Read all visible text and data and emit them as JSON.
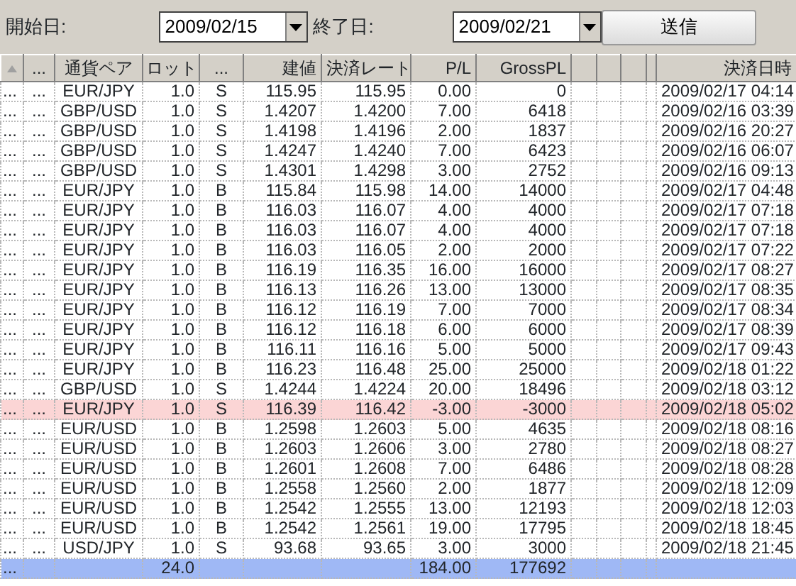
{
  "filter": {
    "start_label": "開始日:",
    "start_value": "2009/02/15",
    "end_label": "終了日:",
    "end_value": "2009/02/21",
    "submit": "送信"
  },
  "table": {
    "columns": [
      null,
      "...",
      "通貨ペア",
      "ロット",
      "...",
      "建値",
      "決済レート",
      "P/L",
      "GrossPL",
      null,
      null,
      null,
      null,
      "決済日時"
    ],
    "rows": [
      {
        "highlighted": false,
        "cells": [
          "...",
          "...",
          "EUR/JPY",
          "1.0",
          "S",
          "115.95",
          "115.95",
          "0.00",
          "0",
          null,
          null,
          null,
          null,
          "2009/02/17 04:14"
        ]
      },
      {
        "highlighted": false,
        "cells": [
          "...",
          "...",
          "GBP/USD",
          "1.0",
          "S",
          "1.4207",
          "1.4200",
          "7.00",
          "6418",
          null,
          null,
          null,
          null,
          "2009/02/16 03:39"
        ]
      },
      {
        "highlighted": false,
        "cells": [
          "...",
          "...",
          "GBP/USD",
          "1.0",
          "S",
          "1.4198",
          "1.4196",
          "2.00",
          "1837",
          null,
          null,
          null,
          null,
          "2009/02/16 20:27"
        ]
      },
      {
        "highlighted": false,
        "cells": [
          "...",
          "...",
          "GBP/USD",
          "1.0",
          "S",
          "1.4247",
          "1.4240",
          "7.00",
          "6423",
          null,
          null,
          null,
          null,
          "2009/02/16 06:07"
        ]
      },
      {
        "highlighted": false,
        "cells": [
          "...",
          "...",
          "GBP/USD",
          "1.0",
          "S",
          "1.4301",
          "1.4298",
          "3.00",
          "2752",
          null,
          null,
          null,
          null,
          "2009/02/16 09:13"
        ]
      },
      {
        "highlighted": false,
        "cells": [
          "...",
          "...",
          "EUR/JPY",
          "1.0",
          "B",
          "115.84",
          "115.98",
          "14.00",
          "14000",
          null,
          null,
          null,
          null,
          "2009/02/17 04:48"
        ]
      },
      {
        "highlighted": false,
        "cells": [
          "...",
          "...",
          "EUR/JPY",
          "1.0",
          "B",
          "116.03",
          "116.07",
          "4.00",
          "4000",
          null,
          null,
          null,
          null,
          "2009/02/17 07:18"
        ]
      },
      {
        "highlighted": false,
        "cells": [
          "...",
          "...",
          "EUR/JPY",
          "1.0",
          "B",
          "116.03",
          "116.07",
          "4.00",
          "4000",
          null,
          null,
          null,
          null,
          "2009/02/17 07:18"
        ]
      },
      {
        "highlighted": false,
        "cells": [
          "...",
          "...",
          "EUR/JPY",
          "1.0",
          "B",
          "116.03",
          "116.05",
          "2.00",
          "2000",
          null,
          null,
          null,
          null,
          "2009/02/17 07:22"
        ]
      },
      {
        "highlighted": false,
        "cells": [
          "...",
          "...",
          "EUR/JPY",
          "1.0",
          "B",
          "116.19",
          "116.35",
          "16.00",
          "16000",
          null,
          null,
          null,
          null,
          "2009/02/17 08:27"
        ]
      },
      {
        "highlighted": false,
        "cells": [
          "...",
          "...",
          "EUR/JPY",
          "1.0",
          "B",
          "116.13",
          "116.26",
          "13.00",
          "13000",
          null,
          null,
          null,
          null,
          "2009/02/17 08:35"
        ]
      },
      {
        "highlighted": false,
        "cells": [
          "...",
          "...",
          "EUR/JPY",
          "1.0",
          "B",
          "116.12",
          "116.19",
          "7.00",
          "7000",
          null,
          null,
          null,
          null,
          "2009/02/17 08:34"
        ]
      },
      {
        "highlighted": false,
        "cells": [
          "...",
          "...",
          "EUR/JPY",
          "1.0",
          "B",
          "116.12",
          "116.18",
          "6.00",
          "6000",
          null,
          null,
          null,
          null,
          "2009/02/17 08:39"
        ]
      },
      {
        "highlighted": false,
        "cells": [
          "...",
          "...",
          "EUR/JPY",
          "1.0",
          "B",
          "116.11",
          "116.16",
          "5.00",
          "5000",
          null,
          null,
          null,
          null,
          "2009/02/17 09:43"
        ]
      },
      {
        "highlighted": false,
        "cells": [
          "...",
          "...",
          "EUR/JPY",
          "1.0",
          "B",
          "116.23",
          "116.48",
          "25.00",
          "25000",
          null,
          null,
          null,
          null,
          "2009/02/18 01:22"
        ]
      },
      {
        "highlighted": false,
        "cells": [
          "...",
          "...",
          "GBP/USD",
          "1.0",
          "S",
          "1.4244",
          "1.4224",
          "20.00",
          "18496",
          null,
          null,
          null,
          null,
          "2009/02/18 03:12"
        ]
      },
      {
        "highlighted": true,
        "cells": [
          "...",
          "...",
          "EUR/JPY",
          "1.0",
          "S",
          "116.39",
          "116.42",
          "-3.00",
          "-3000",
          null,
          null,
          null,
          null,
          "2009/02/18 05:02"
        ]
      },
      {
        "highlighted": false,
        "cells": [
          "...",
          "...",
          "EUR/USD",
          "1.0",
          "B",
          "1.2598",
          "1.2603",
          "5.00",
          "4635",
          null,
          null,
          null,
          null,
          "2009/02/18 08:16"
        ]
      },
      {
        "highlighted": false,
        "cells": [
          "...",
          "...",
          "EUR/USD",
          "1.0",
          "B",
          "1.2603",
          "1.2606",
          "3.00",
          "2780",
          null,
          null,
          null,
          null,
          "2009/02/18 08:27"
        ]
      },
      {
        "highlighted": false,
        "cells": [
          "...",
          "...",
          "EUR/USD",
          "1.0",
          "B",
          "1.2601",
          "1.2608",
          "7.00",
          "6486",
          null,
          null,
          null,
          null,
          "2009/02/18 08:28"
        ]
      },
      {
        "highlighted": false,
        "cells": [
          "...",
          "...",
          "EUR/USD",
          "1.0",
          "B",
          "1.2558",
          "1.2560",
          "2.00",
          "1877",
          null,
          null,
          null,
          null,
          "2009/02/18 12:09"
        ]
      },
      {
        "highlighted": false,
        "cells": [
          "...",
          "...",
          "EUR/USD",
          "1.0",
          "B",
          "1.2542",
          "1.2555",
          "13.00",
          "12193",
          null,
          null,
          null,
          null,
          "2009/02/18 12:03"
        ]
      },
      {
        "highlighted": false,
        "cells": [
          "...",
          "...",
          "EUR/USD",
          "1.0",
          "B",
          "1.2542",
          "1.2561",
          "19.00",
          "17795",
          null,
          null,
          null,
          null,
          "2009/02/18 18:45"
        ]
      },
      {
        "highlighted": false,
        "cells": [
          "...",
          "...",
          "USD/JPY",
          "1.0",
          "S",
          "93.68",
          "93.65",
          "3.00",
          "3000",
          null,
          null,
          null,
          null,
          "2009/02/18 21:45"
        ]
      }
    ],
    "totals": {
      "marker": "...",
      "lot": "24.0",
      "pl": "184.00",
      "gross_pl": "177692"
    }
  }
}
